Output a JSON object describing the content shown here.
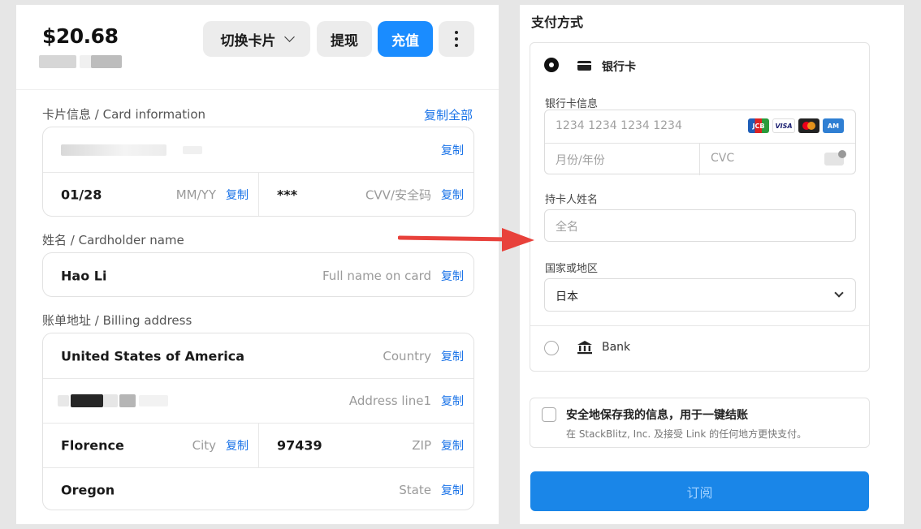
{
  "left": {
    "balance": "$20.68",
    "buttons": {
      "switch_card": "切换卡片",
      "withdraw": "提现",
      "recharge": "充值"
    },
    "card_section": {
      "label": "卡片信息 / Card information",
      "copy_all": "复制全部",
      "expiry_value": "01/28",
      "expiry_hint": "MM/YY",
      "cvv_value": "***",
      "cvv_hint": "CVV/安全码"
    },
    "copy_label": "复制",
    "name_section": {
      "label": "姓名 / Cardholder name",
      "value": "Hao Li",
      "hint": "Full name on card"
    },
    "address_section": {
      "label": "账单地址 / Billing address",
      "country_value": "United States of America",
      "country_hint": "Country",
      "address_hint": "Address line1",
      "city_value": "Florence",
      "city_hint": "City",
      "zip_value": "97439",
      "zip_hint": "ZIP",
      "state_value": "Oregon",
      "state_hint": "State"
    }
  },
  "right": {
    "title": "支付方式",
    "method_card": "银行卡",
    "card_info_label": "银行卡信息",
    "card_number_placeholder": "1234 1234 1234 1234",
    "card_brands": [
      "JCB",
      "VISA",
      "Mastercard",
      "Amex"
    ],
    "expiry_placeholder": "月份/年份",
    "cvc_placeholder": "CVC",
    "holder_label": "持卡人姓名",
    "holder_placeholder": "全名",
    "country_label": "国家或地区",
    "country_value": "日本",
    "method_bank": "Bank",
    "save_title": "安全地保存我的信息，用于一键结账",
    "save_desc": "在 StackBlitz, Inc. 及接受 Link 的任何地方更快支付。",
    "submit": "订阅"
  },
  "colors": {
    "accent": "#1a8cff",
    "link": "#1a73e8",
    "arrow": "#e8413b"
  }
}
